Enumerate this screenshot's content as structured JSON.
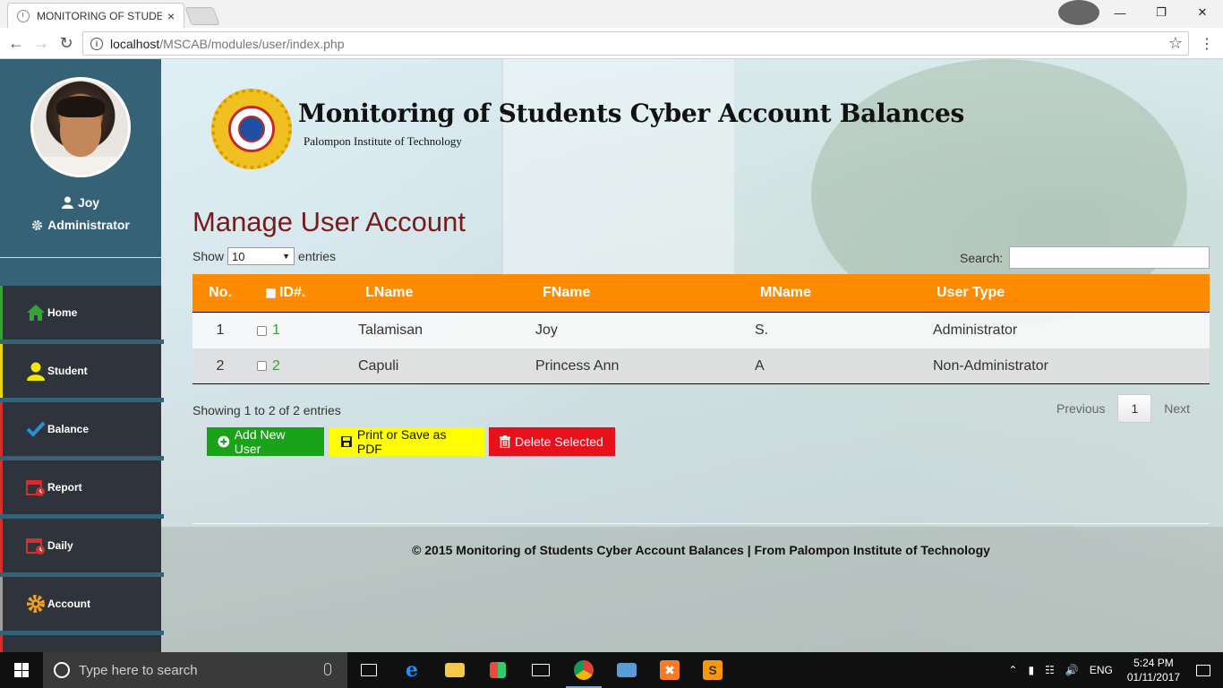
{
  "browser": {
    "tab_title": "MONITORING OF STUDE",
    "tab_close": "×",
    "url_host": "localhost",
    "url_path": "/MSCAB/modules/user/index.php",
    "window_controls": [
      "minimize",
      "restore",
      "close"
    ],
    "icons": [
      "back-icon",
      "forward-icon",
      "reload-icon",
      "info-icon",
      "star-icon",
      "menu-icon",
      "profile-icon"
    ]
  },
  "sidebar": {
    "user_name": "Joy",
    "user_role": "Administrator",
    "items": [
      {
        "label": "Home",
        "icon": "home-icon",
        "color": "#3aa13a"
      },
      {
        "label": "Student",
        "icon": "user-icon",
        "color": "#e8d70f"
      },
      {
        "label": "Balance",
        "icon": "checkmark-icon",
        "color": "#2a8fd6"
      },
      {
        "label": "Report",
        "icon": "calendar-icon",
        "color": "#d32f2f"
      },
      {
        "label": "Daily",
        "icon": "calendar-icon",
        "color": "#d32f2f"
      },
      {
        "label": "Account",
        "icon": "gear-icon",
        "color": "#f0a020"
      }
    ]
  },
  "header": {
    "site_title": "Monitoring of Students Cyber Account Balances",
    "site_subtitle": "Palompon Institute of Technology"
  },
  "main": {
    "page_title": "Manage User Account",
    "show_label": "Show",
    "show_value": "10",
    "entries_label": "entries",
    "search_label": "Search:",
    "search_value": "",
    "table": {
      "columns": [
        "No.",
        "ID#.",
        "LName",
        "FName",
        "MName",
        "User Type"
      ],
      "rows": [
        {
          "no": "1",
          "id": "1",
          "lname": "Talamisan",
          "fname": "Joy",
          "mname": "S.",
          "user_type": "Administrator"
        },
        {
          "no": "2",
          "id": "2",
          "lname": "Capuli",
          "fname": "Princess Ann",
          "mname": "A",
          "user_type": "Non-Administrator"
        }
      ]
    },
    "info": "Showing 1 to 2 of 2 entries",
    "pager": {
      "previous": "Previous",
      "current": "1",
      "next": "Next"
    },
    "buttons": {
      "add": "Add New User",
      "print": "Print or Save as PDF",
      "delete": "Delete Selected"
    },
    "colors": {
      "header_bg": "#ff8c00",
      "add": "#1aa31a",
      "print": "#ffff00",
      "delete": "#e8101a",
      "title": "#7b1a1a"
    }
  },
  "footer": {
    "text": "© 2015 Monitoring of Students Cyber Account Balances | From Palompon Institute of Technology"
  },
  "taskbar": {
    "search_placeholder": "Type here to search",
    "apps": [
      "task-view-icon",
      "edge-icon",
      "file-explorer-icon",
      "store-icon",
      "mail-icon",
      "chrome-icon",
      "remote-desktop-icon",
      "xampp-icon",
      "sublime-icon"
    ],
    "language": "ENG",
    "time": "5:24 PM",
    "date": "01/11/2017"
  }
}
